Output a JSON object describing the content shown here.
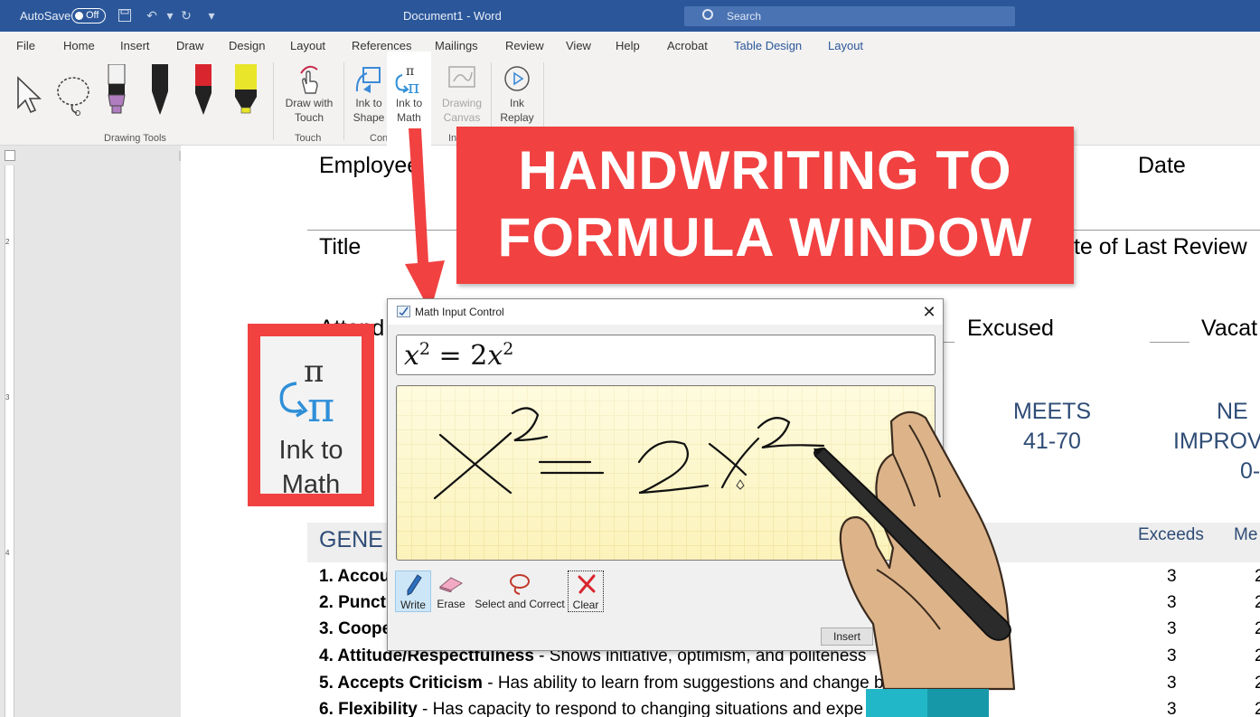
{
  "titlebar": {
    "autosave_label": "AutoSave",
    "autosave_state": "Off",
    "doc_title": "Document1 - Word",
    "search_placeholder": "Search"
  },
  "tabs": [
    "File",
    "Home",
    "Insert",
    "Draw",
    "Design",
    "Layout",
    "References",
    "Mailings",
    "Review",
    "View",
    "Help",
    "Acrobat",
    "Table Design",
    "Layout"
  ],
  "active_tab": "Draw",
  "ribbon": {
    "groups": {
      "drawing_tools": "Drawing Tools",
      "touch": "Touch",
      "convert": "Conve",
      "insert": "In"
    },
    "draw_with_touch": [
      "Draw with",
      "Touch"
    ],
    "ink_to_shape": [
      "Ink to",
      "Shape"
    ],
    "ink_to_math": [
      "Ink to",
      "Math"
    ],
    "drawing_canvas": [
      "Drawing",
      "Canvas"
    ],
    "ink_replay": [
      "Ink",
      "Replay"
    ]
  },
  "ruler": {
    "top_numbers": [
      "1",
      "6"
    ],
    "left_numbers": [
      "2",
      "3",
      "4"
    ]
  },
  "document": {
    "employee": "Employee",
    "date": "Date",
    "title": "Title",
    "last_review": "Date of Last Review",
    "attendance": "Attend",
    "excused": "Excused",
    "vacation": "Vacat",
    "meets": [
      "MEETS",
      "41-70"
    ],
    "needs": [
      "NE",
      "IMPROV",
      "0-"
    ],
    "general": "GENE",
    "exceeds_head": "Exceeds",
    "meets_head": "Me",
    "rows": [
      {
        "bold": "1. Accou",
        "rest": "",
        "score": "3",
        "score2": "2"
      },
      {
        "bold": "2. Punctu",
        "rest": "",
        "score": "3",
        "score2": "2"
      },
      {
        "bold": "3. Coope",
        "rest": "",
        "score": "3",
        "score2": "2"
      },
      {
        "bold": "4. Attitude/Respectfulness",
        "rest": " - Shows initiative, optimism, and politeness",
        "score": "3",
        "score2": "2"
      },
      {
        "bold": "5. Accepts Criticism",
        "rest": " - Has ability to learn from suggestions and change b",
        "score": "3",
        "score2": "2"
      },
      {
        "bold": "6. Flexibility",
        "rest": " - Has capacity to respond to changing situations and expe",
        "score": "3",
        "score2": "2"
      }
    ]
  },
  "zoom_badge": {
    "line1": "Ink to",
    "line2": "Math"
  },
  "banner": {
    "line1": "HANDWRITING TO",
    "line2": "FORMULA WINDOW"
  },
  "dialog": {
    "title": "Math Input Control",
    "preview": {
      "base1": "x",
      "sup1": "2",
      "op": " = 2",
      "base2": "x",
      "sup2": "2"
    },
    "tools": [
      "Write",
      "Erase",
      "Select and Correct",
      "Clear"
    ],
    "insert": "Insert"
  },
  "colors": {
    "word_blue": "#2b579a",
    "banner_red": "#f14141",
    "doc_heading_blue": "#2e4c76"
  }
}
